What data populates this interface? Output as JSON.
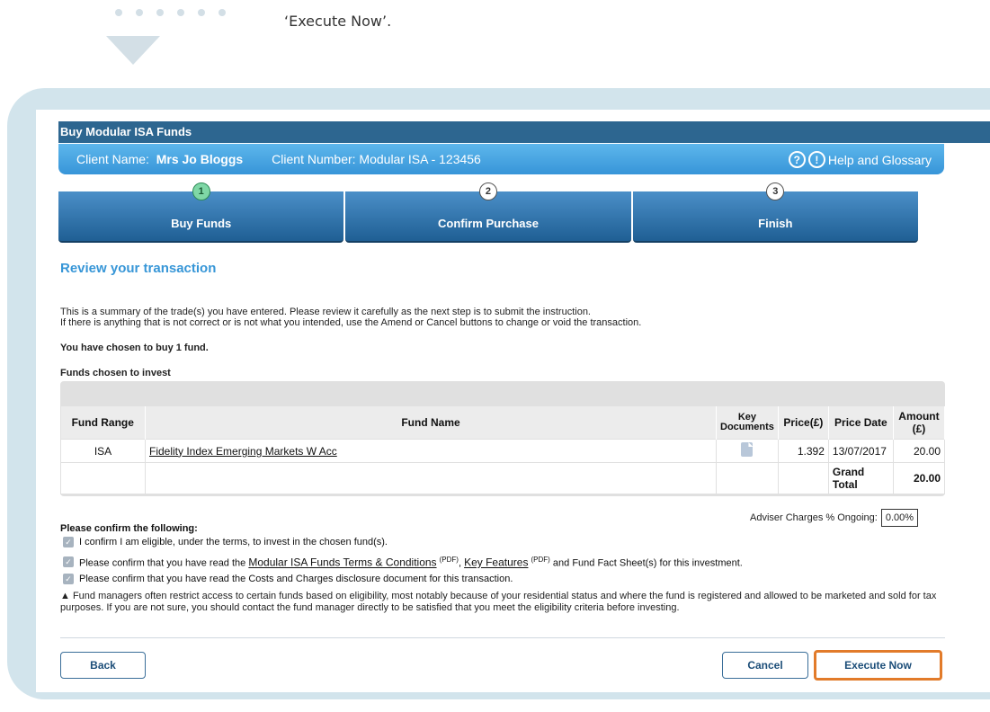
{
  "caption": "‘Execute Now’.",
  "title_bar": "Buy Modular ISA Funds",
  "client": {
    "name_label": "Client Name:",
    "name_value": "Mrs Jo Bloggs",
    "number": "Client Number: Modular ISA - 123456",
    "help": "Help and Glossary"
  },
  "steps": [
    {
      "num": "1",
      "label": "Buy Funds"
    },
    {
      "num": "2",
      "label": "Confirm Purchase"
    },
    {
      "num": "3",
      "label": "Finish"
    }
  ],
  "review_heading": "Review your transaction",
  "summary_line1": "This is a summary of the trade(s) you have entered. Please review it carefully as the next step is to submit the instruction.",
  "summary_line2": "If there is anything that is not correct or is not what you intended, use the Amend or Cancel buttons to change or void the transaction.",
  "chosen_text": "You have chosen to buy 1 fund.",
  "funds_heading": "Funds chosen to invest",
  "table": {
    "headers": [
      "Fund Range",
      "Fund Name",
      "Key Documents",
      "Price(£)",
      "Price Date",
      "Amount (£)"
    ],
    "row": {
      "range": "ISA",
      "name": "Fidelity Index Emerging Markets W Acc",
      "price": "1.392",
      "date": "13/07/2017",
      "amount": "20.00"
    },
    "total_label": "Grand Total",
    "total_value": "20.00"
  },
  "adviser_label": "Adviser Charges % Ongoing:",
  "adviser_value": "0.00%",
  "confirm_heading": "Please confirm the following:",
  "confirm1": "I confirm I am eligible, under the terms, to invest in the chosen fund(s).",
  "confirm2_a": "Please confirm that you have read the",
  "confirm2_link1": "Modular ISA Funds Terms & Conditions",
  "confirm2_pdf": "(PDF)",
  "confirm2_comma": ",",
  "confirm2_link2": "Key Features",
  "confirm2_b": "and Fund Fact Sheet(s) for this investment.",
  "confirm3": "Please confirm that you have read the Costs and Charges disclosure document for this transaction.",
  "warning": "Fund managers often restrict access to certain funds based on eligibility, most notably because of your residential status and where the fund is registered and allowed to be marketed and sold for tax purposes. If you are not sure, you should contact the fund manager directly to be satisfied that you meet the eligibility criteria before investing.",
  "buttons": {
    "back": "Back",
    "cancel": "Cancel",
    "execute": "Execute Now"
  }
}
